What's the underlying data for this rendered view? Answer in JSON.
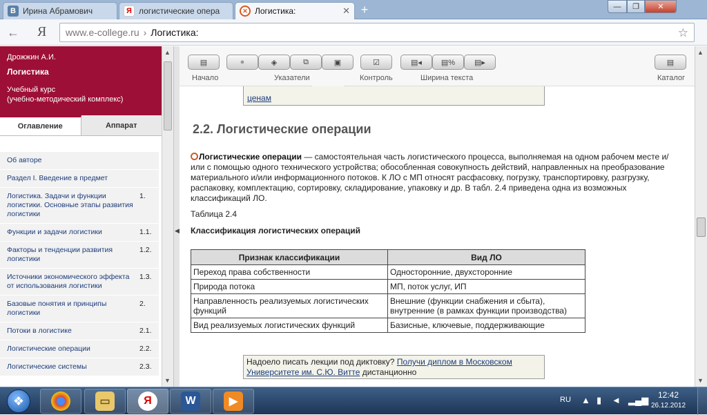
{
  "browser": {
    "tabs": [
      {
        "label": "Ирина Абрамович",
        "icon": "vk-icon",
        "active": false
      },
      {
        "label": "логистические опера",
        "icon": "yandex-icon",
        "active": false
      },
      {
        "label": "Логистика:",
        "icon": "ecollege-icon",
        "active": true
      }
    ],
    "back": "←",
    "yandex_logo": "Я",
    "address": {
      "host": "www.e-college.ru",
      "separator": "›",
      "page": "Логистика:"
    },
    "star": "☆",
    "new_tab": "+",
    "controls": {
      "minimize": "—",
      "restore": "❐",
      "close": "✕"
    }
  },
  "sidebar": {
    "author": "Дрожжин А.И.",
    "course": "Логистика",
    "subtitle_1": "Учебный курс",
    "subtitle_2": "(учебно-методический комплекс)",
    "tab_contents": "Оглавление",
    "tab_apparatus": "Аппарат",
    "toc": [
      {
        "label": "Об авторе",
        "num": ""
      },
      {
        "label": "Раздел I. Введение в предмет",
        "num": ""
      },
      {
        "label": "Логистика. Задачи и функции логистики. Основные этапы развития логистики",
        "num": "1."
      },
      {
        "label": "Функции и задачи логистики",
        "num": "1.1."
      },
      {
        "label": "Факторы и тенденции развития логистики",
        "num": "1.2."
      },
      {
        "label": "Источники экономического эффекта от использования логистики",
        "num": "1.3."
      },
      {
        "label": "Базовые понятия и принципы логистики",
        "num": "2."
      },
      {
        "label": "Потоки в логистике",
        "num": "2.1."
      },
      {
        "label": "Логистические операции",
        "num": "2.2."
      },
      {
        "label": "Логистические системы",
        "num": "2.3."
      }
    ]
  },
  "toolbar": {
    "home": "Начало",
    "pointers": "Указатели",
    "control": "Контроль",
    "text_width": "Ширина текста",
    "catalog": "Каталог"
  },
  "content": {
    "prev_link": "ценам",
    "section_title": "2.2. Логистические операции",
    "term": "Логистические операции",
    "definition": " — самостоятельная часть логистического процесса, выполняемая на одном рабочем месте и/или с помощью одного технического устройства; обособленная совокупность действий, направленных на преобразование материального и/или информационного потоков. К ЛО с МП относят расфасовку, погрузку, транспортировку, разгрузку, распаковку, комплектацию, сортировку, складирование, упаковку и др. В табл. 2.4 приведена одна из возможных классификаций ЛО.",
    "table_caption": "Таблица 2.4",
    "table_title": "Классификация логистических операций",
    "table": {
      "headers": [
        "Признак классификации",
        "Вид ЛО"
      ],
      "rows": [
        [
          "Переход права собственности",
          "Односторонние, двухсторонние"
        ],
        [
          "Природа потока",
          "МП, поток услуг, ИП"
        ],
        [
          "Направленность реализуемых логистических функций",
          "Внешние (функции снабжения и сбыта), внутренние (в рамках функции производства)"
        ],
        [
          "Вид реализуемых логистических функций",
          "Базисные, ключевые, поддерживающие"
        ]
      ]
    },
    "promo_prefix": "Надоело писать лекции под диктовку? ",
    "promo_link": "Получи диплом в Московском Университете им. С.Ю. Витте",
    "promo_suffix": " дистанционно"
  },
  "taskbar": {
    "lang": "RU",
    "time": "12:42",
    "date": "26.12.2012",
    "tasks": [
      "chrome-icon",
      "explorer-icon",
      "yandex-browser-icon",
      "word-icon",
      "media-player-icon"
    ]
  }
}
